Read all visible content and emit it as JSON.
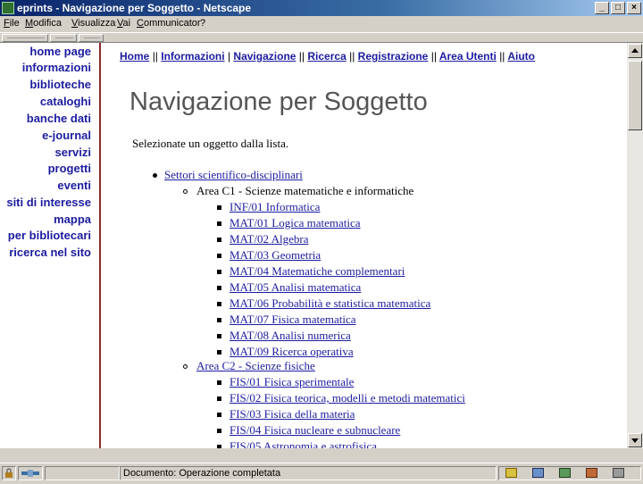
{
  "window": {
    "title": "eprints - Navigazione per Soggetto - Netscape",
    "minimize": "_",
    "maximize": "□",
    "close": "×"
  },
  "menu": {
    "items": [
      "File",
      "Modifica",
      "Visualizza",
      "Vai",
      "Communicator",
      "?"
    ]
  },
  "sidebar": {
    "links": [
      "home page",
      "informazioni",
      "biblioteche",
      "cataloghi",
      "banche dati",
      "e-journal",
      "servizi",
      "progetti",
      "eventi",
      "siti di interesse",
      "mappa",
      "per bibliotecari",
      "ricerca nel sito"
    ]
  },
  "topnav": {
    "home": "Home",
    "info": "Informazioni",
    "nav": "Navigazione",
    "search": "Ricerca",
    "register": "Registrazione",
    "users": "Area Utenti",
    "help": "Aiuto",
    "sep": "||",
    "sep_single": "|"
  },
  "page": {
    "title": "Navigazione per Soggetto",
    "intro": "Selezionate un oggetto dalla lista."
  },
  "tree": {
    "root": "Settori scientifico-disciplinari",
    "area1": {
      "label": "Area C1 - Scienze matematiche e informatiche",
      "items": [
        "INF/01 Informatica",
        "MAT/01 Logica matematica",
        "MAT/02 Algebra",
        "MAT/03 Geometria",
        "MAT/04 Matematiche complementari",
        "MAT/05 Analisi matematica",
        "MAT/06 Probabilità e statistica matematica",
        "MAT/07 Fisica matematica",
        "MAT/08 Analisi numerica",
        "MAT/09 Ricerca operativa"
      ]
    },
    "area2": {
      "label": "Area C2 - Scienze fisiche",
      "items": [
        "FIS/01 Fisica sperimentale",
        "FIS/02 Fisica teorica, modelli e metodi matematici",
        "FIS/03 Fisica della materia",
        "FIS/04 Fisica nucleare e subnucleare",
        "FIS/05 Astronomia e astrofisica"
      ]
    }
  },
  "status": {
    "text": "Documento: Operazione completata"
  }
}
